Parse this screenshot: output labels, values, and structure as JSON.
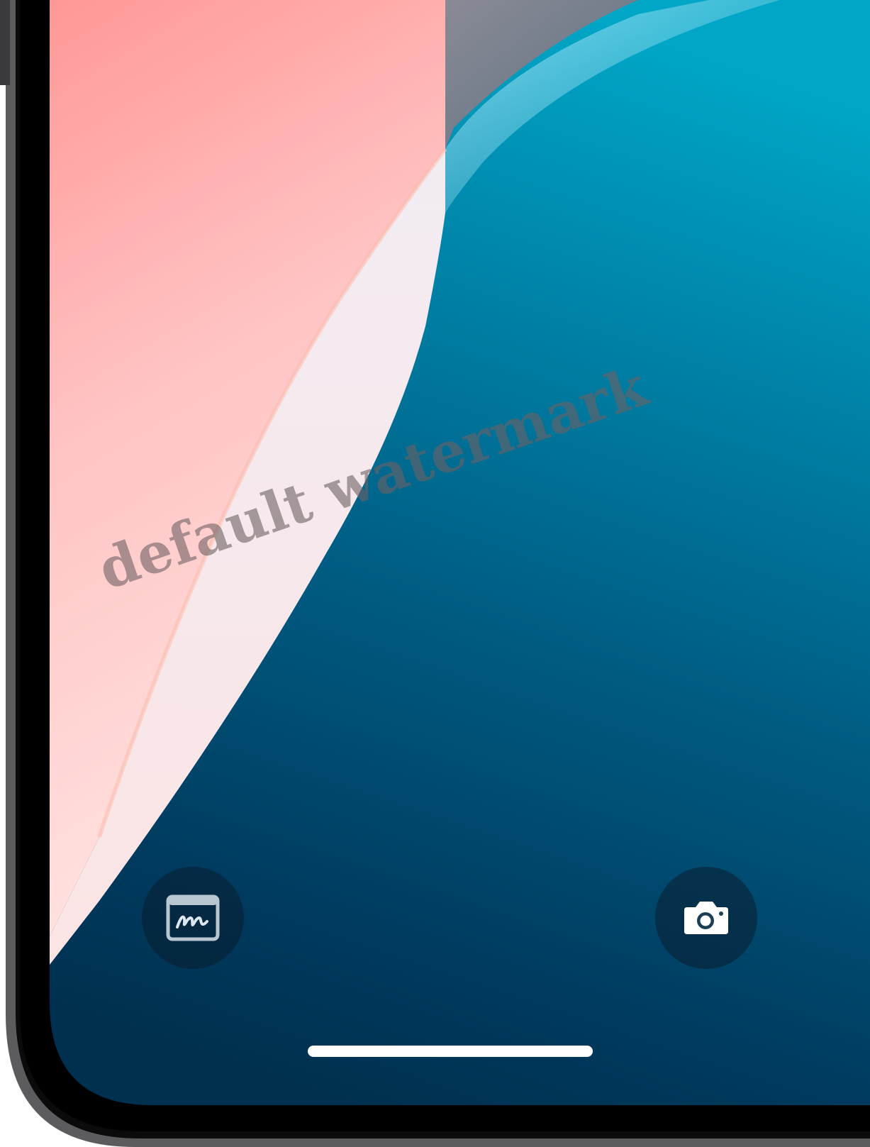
{
  "screen": {
    "name": "iPhone lock screen (bottom portion)",
    "wallpaper_colors": {
      "coral_pink": "#FF9C9A",
      "light_pink": "#FADCDC",
      "blush_white": "#F5E8EC",
      "teal_blue": "#009CC0",
      "deep_navy": "#00304F",
      "slate_gray": "#7E8590",
      "frame": "#000000",
      "bezel": "#6B6B6B"
    }
  },
  "shortcuts": {
    "left": {
      "icon": "signature-icon"
    },
    "right": {
      "icon": "camera-icon"
    }
  },
  "home_indicator": {
    "color": "#FFFFFF"
  },
  "watermark": {
    "text": "default watermark"
  }
}
